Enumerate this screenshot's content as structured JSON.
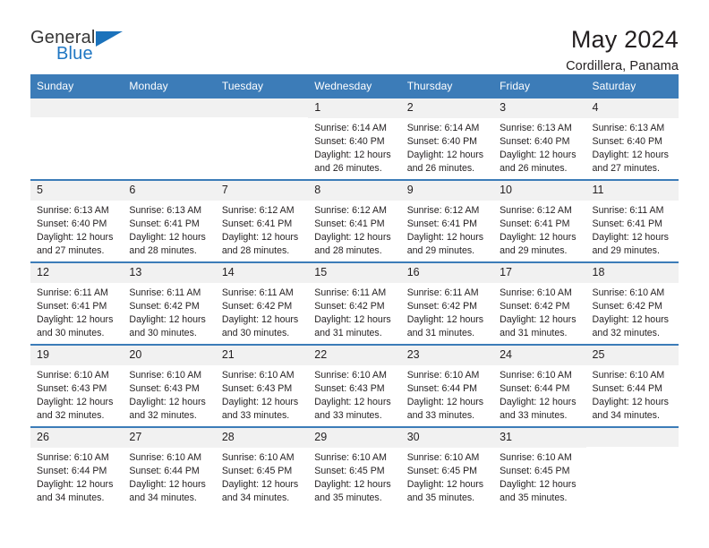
{
  "logo": {
    "word_one": "General",
    "word_two": "Blue",
    "triangle_icon": "triangle-icon"
  },
  "header": {
    "title": "May 2024",
    "subtitle": "Cordillera, Panama"
  },
  "calendar": {
    "weekday_headers": [
      "Sunday",
      "Monday",
      "Tuesday",
      "Wednesday",
      "Thursday",
      "Friday",
      "Saturday"
    ],
    "colors": {
      "header_blue": "#3c7cb8",
      "daynum_gray": "#f1f1f1",
      "logo_blue": "#2077c3",
      "text": "#231f20"
    },
    "weeks": [
      [
        {
          "day": "",
          "sunrise": "",
          "sunset": "",
          "daylight_line1": "",
          "daylight_line2": ""
        },
        {
          "day": "",
          "sunrise": "",
          "sunset": "",
          "daylight_line1": "",
          "daylight_line2": ""
        },
        {
          "day": "",
          "sunrise": "",
          "sunset": "",
          "daylight_line1": "",
          "daylight_line2": ""
        },
        {
          "day": "1",
          "sunrise": "Sunrise: 6:14 AM",
          "sunset": "Sunset: 6:40 PM",
          "daylight_line1": "Daylight: 12 hours",
          "daylight_line2": "and 26 minutes."
        },
        {
          "day": "2",
          "sunrise": "Sunrise: 6:14 AM",
          "sunset": "Sunset: 6:40 PM",
          "daylight_line1": "Daylight: 12 hours",
          "daylight_line2": "and 26 minutes."
        },
        {
          "day": "3",
          "sunrise": "Sunrise: 6:13 AM",
          "sunset": "Sunset: 6:40 PM",
          "daylight_line1": "Daylight: 12 hours",
          "daylight_line2": "and 26 minutes."
        },
        {
          "day": "4",
          "sunrise": "Sunrise: 6:13 AM",
          "sunset": "Sunset: 6:40 PM",
          "daylight_line1": "Daylight: 12 hours",
          "daylight_line2": "and 27 minutes."
        }
      ],
      [
        {
          "day": "5",
          "sunrise": "Sunrise: 6:13 AM",
          "sunset": "Sunset: 6:40 PM",
          "daylight_line1": "Daylight: 12 hours",
          "daylight_line2": "and 27 minutes."
        },
        {
          "day": "6",
          "sunrise": "Sunrise: 6:13 AM",
          "sunset": "Sunset: 6:41 PM",
          "daylight_line1": "Daylight: 12 hours",
          "daylight_line2": "and 28 minutes."
        },
        {
          "day": "7",
          "sunrise": "Sunrise: 6:12 AM",
          "sunset": "Sunset: 6:41 PM",
          "daylight_line1": "Daylight: 12 hours",
          "daylight_line2": "and 28 minutes."
        },
        {
          "day": "8",
          "sunrise": "Sunrise: 6:12 AM",
          "sunset": "Sunset: 6:41 PM",
          "daylight_line1": "Daylight: 12 hours",
          "daylight_line2": "and 28 minutes."
        },
        {
          "day": "9",
          "sunrise": "Sunrise: 6:12 AM",
          "sunset": "Sunset: 6:41 PM",
          "daylight_line1": "Daylight: 12 hours",
          "daylight_line2": "and 29 minutes."
        },
        {
          "day": "10",
          "sunrise": "Sunrise: 6:12 AM",
          "sunset": "Sunset: 6:41 PM",
          "daylight_line1": "Daylight: 12 hours",
          "daylight_line2": "and 29 minutes."
        },
        {
          "day": "11",
          "sunrise": "Sunrise: 6:11 AM",
          "sunset": "Sunset: 6:41 PM",
          "daylight_line1": "Daylight: 12 hours",
          "daylight_line2": "and 29 minutes."
        }
      ],
      [
        {
          "day": "12",
          "sunrise": "Sunrise: 6:11 AM",
          "sunset": "Sunset: 6:41 PM",
          "daylight_line1": "Daylight: 12 hours",
          "daylight_line2": "and 30 minutes."
        },
        {
          "day": "13",
          "sunrise": "Sunrise: 6:11 AM",
          "sunset": "Sunset: 6:42 PM",
          "daylight_line1": "Daylight: 12 hours",
          "daylight_line2": "and 30 minutes."
        },
        {
          "day": "14",
          "sunrise": "Sunrise: 6:11 AM",
          "sunset": "Sunset: 6:42 PM",
          "daylight_line1": "Daylight: 12 hours",
          "daylight_line2": "and 30 minutes."
        },
        {
          "day": "15",
          "sunrise": "Sunrise: 6:11 AM",
          "sunset": "Sunset: 6:42 PM",
          "daylight_line1": "Daylight: 12 hours",
          "daylight_line2": "and 31 minutes."
        },
        {
          "day": "16",
          "sunrise": "Sunrise: 6:11 AM",
          "sunset": "Sunset: 6:42 PM",
          "daylight_line1": "Daylight: 12 hours",
          "daylight_line2": "and 31 minutes."
        },
        {
          "day": "17",
          "sunrise": "Sunrise: 6:10 AM",
          "sunset": "Sunset: 6:42 PM",
          "daylight_line1": "Daylight: 12 hours",
          "daylight_line2": "and 31 minutes."
        },
        {
          "day": "18",
          "sunrise": "Sunrise: 6:10 AM",
          "sunset": "Sunset: 6:42 PM",
          "daylight_line1": "Daylight: 12 hours",
          "daylight_line2": "and 32 minutes."
        }
      ],
      [
        {
          "day": "19",
          "sunrise": "Sunrise: 6:10 AM",
          "sunset": "Sunset: 6:43 PM",
          "daylight_line1": "Daylight: 12 hours",
          "daylight_line2": "and 32 minutes."
        },
        {
          "day": "20",
          "sunrise": "Sunrise: 6:10 AM",
          "sunset": "Sunset: 6:43 PM",
          "daylight_line1": "Daylight: 12 hours",
          "daylight_line2": "and 32 minutes."
        },
        {
          "day": "21",
          "sunrise": "Sunrise: 6:10 AM",
          "sunset": "Sunset: 6:43 PM",
          "daylight_line1": "Daylight: 12 hours",
          "daylight_line2": "and 33 minutes."
        },
        {
          "day": "22",
          "sunrise": "Sunrise: 6:10 AM",
          "sunset": "Sunset: 6:43 PM",
          "daylight_line1": "Daylight: 12 hours",
          "daylight_line2": "and 33 minutes."
        },
        {
          "day": "23",
          "sunrise": "Sunrise: 6:10 AM",
          "sunset": "Sunset: 6:44 PM",
          "daylight_line1": "Daylight: 12 hours",
          "daylight_line2": "and 33 minutes."
        },
        {
          "day": "24",
          "sunrise": "Sunrise: 6:10 AM",
          "sunset": "Sunset: 6:44 PM",
          "daylight_line1": "Daylight: 12 hours",
          "daylight_line2": "and 33 minutes."
        },
        {
          "day": "25",
          "sunrise": "Sunrise: 6:10 AM",
          "sunset": "Sunset: 6:44 PM",
          "daylight_line1": "Daylight: 12 hours",
          "daylight_line2": "and 34 minutes."
        }
      ],
      [
        {
          "day": "26",
          "sunrise": "Sunrise: 6:10 AM",
          "sunset": "Sunset: 6:44 PM",
          "daylight_line1": "Daylight: 12 hours",
          "daylight_line2": "and 34 minutes."
        },
        {
          "day": "27",
          "sunrise": "Sunrise: 6:10 AM",
          "sunset": "Sunset: 6:44 PM",
          "daylight_line1": "Daylight: 12 hours",
          "daylight_line2": "and 34 minutes."
        },
        {
          "day": "28",
          "sunrise": "Sunrise: 6:10 AM",
          "sunset": "Sunset: 6:45 PM",
          "daylight_line1": "Daylight: 12 hours",
          "daylight_line2": "and 34 minutes."
        },
        {
          "day": "29",
          "sunrise": "Sunrise: 6:10 AM",
          "sunset": "Sunset: 6:45 PM",
          "daylight_line1": "Daylight: 12 hours",
          "daylight_line2": "and 35 minutes."
        },
        {
          "day": "30",
          "sunrise": "Sunrise: 6:10 AM",
          "sunset": "Sunset: 6:45 PM",
          "daylight_line1": "Daylight: 12 hours",
          "daylight_line2": "and 35 minutes."
        },
        {
          "day": "31",
          "sunrise": "Sunrise: 6:10 AM",
          "sunset": "Sunset: 6:45 PM",
          "daylight_line1": "Daylight: 12 hours",
          "daylight_line2": "and 35 minutes."
        },
        {
          "day": "",
          "sunrise": "",
          "sunset": "",
          "daylight_line1": "",
          "daylight_line2": ""
        }
      ]
    ]
  }
}
